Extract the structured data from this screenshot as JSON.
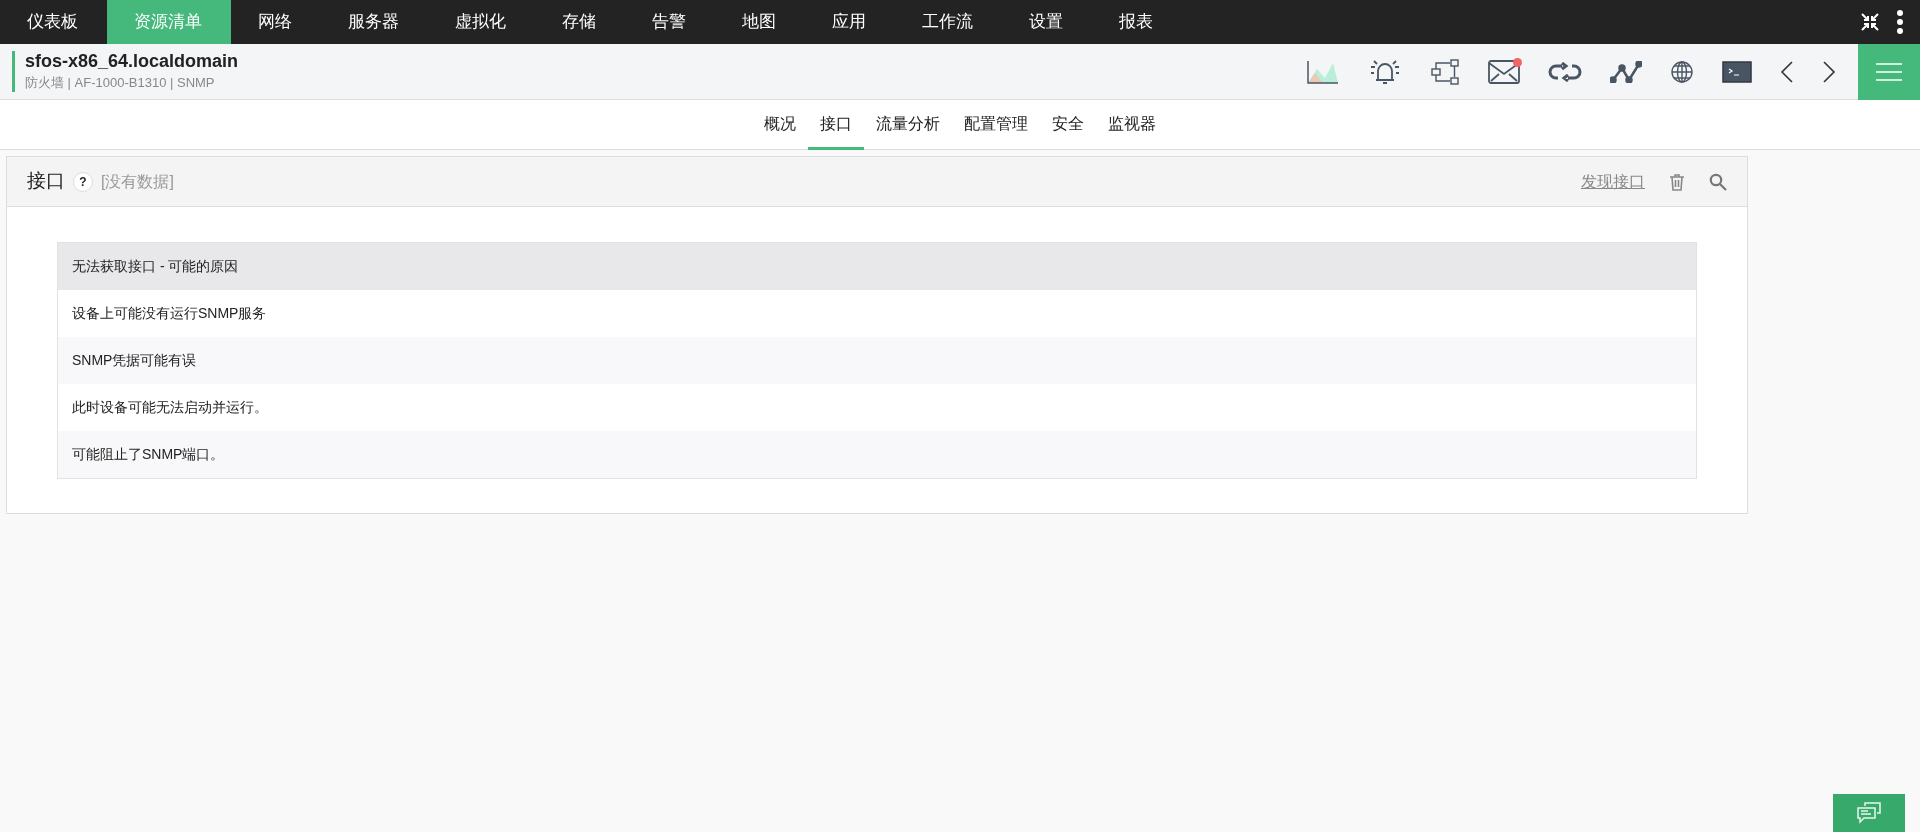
{
  "top_nav": {
    "items": [
      {
        "label": "仪表板",
        "selected": false
      },
      {
        "label": "资源清单",
        "selected": true
      },
      {
        "label": "网络",
        "selected": false
      },
      {
        "label": "服务器",
        "selected": false
      },
      {
        "label": "虚拟化",
        "selected": false
      },
      {
        "label": "存储",
        "selected": false
      },
      {
        "label": "告警",
        "selected": false
      },
      {
        "label": "地图",
        "selected": false
      },
      {
        "label": "应用",
        "selected": false
      },
      {
        "label": "工作流",
        "selected": false
      },
      {
        "label": "设置",
        "selected": false
      },
      {
        "label": "报表",
        "selected": false
      }
    ]
  },
  "device": {
    "name": "sfos-x86_64.localdomain",
    "details": "防火墙 | AF-1000-B1310  | SNMP"
  },
  "toolbar": [
    {
      "kind": "chart",
      "alert": false
    },
    {
      "kind": "bell",
      "alert": false
    },
    {
      "kind": "workflow",
      "alert": false
    },
    {
      "kind": "mail",
      "alert": true
    },
    {
      "kind": "loop",
      "alert": false
    },
    {
      "kind": "graph",
      "alert": false
    },
    {
      "kind": "globe",
      "alert": false
    },
    {
      "kind": "terminal",
      "alert": false
    },
    {
      "kind": "prev",
      "alert": false
    },
    {
      "kind": "next",
      "alert": false
    }
  ],
  "sub_tabs": [
    {
      "label": "概况",
      "selected": false
    },
    {
      "label": "接口",
      "selected": true
    },
    {
      "label": "流量分析",
      "selected": false
    },
    {
      "label": "配置管理",
      "selected": false
    },
    {
      "label": "安全",
      "selected": false
    },
    {
      "label": "监视器",
      "selected": false
    }
  ],
  "panel": {
    "title": "接口",
    "help": "?",
    "status": "[没有数据]",
    "discover_link": "发现接口",
    "table": {
      "header": "无法获取接口 - 可能的原因",
      "rows": [
        "设备上可能没有运行SNMP服务",
        "SNMP凭据可能有误",
        "此时设备可能无法启动并运行。",
        "可能阻止了SNMP端口。"
      ]
    }
  }
}
